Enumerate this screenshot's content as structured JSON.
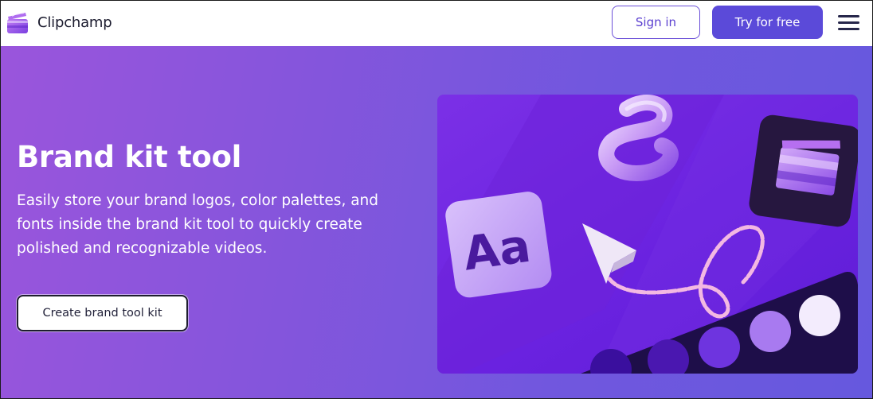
{
  "header": {
    "brand_name": "Clipchamp",
    "sign_in_label": "Sign in",
    "try_label": "Try for free",
    "logo_icon": "clipchamp-logo-icon",
    "menu_icon": "hamburger-menu-icon"
  },
  "hero": {
    "title": "Brand kit tool",
    "description": "Easily store your brand logos, color palettes, and fonts inside the brand kit tool to quickly create polished and recognizable videos.",
    "cta_label": "Create brand tool kit",
    "illustration": {
      "font_tile_text": "Aa",
      "palette_swatch_colors": [
        "#3a0f9e",
        "#6e34df",
        "#a87af0",
        "#cfb2f7",
        "#f3ecfd"
      ]
    }
  },
  "colors": {
    "accent": "#5b4ad9",
    "hero_gradient_start": "#9a55dc",
    "hero_gradient_end": "#6658de"
  }
}
